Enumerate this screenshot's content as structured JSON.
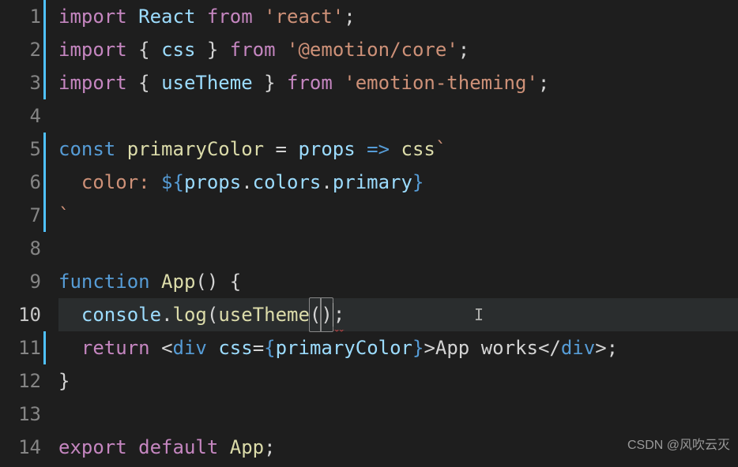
{
  "editor": {
    "activeLine": 10,
    "modifiedLines": [
      1,
      2,
      3,
      5,
      6,
      7,
      11
    ],
    "lines": [
      {
        "num": 1,
        "tokens": [
          {
            "cls": "tk-keyword",
            "t": "import"
          },
          {
            "cls": "tk-text",
            "t": " "
          },
          {
            "cls": "tk-var",
            "t": "React"
          },
          {
            "cls": "tk-text",
            "t": " "
          },
          {
            "cls": "tk-keyword",
            "t": "from"
          },
          {
            "cls": "tk-text",
            "t": " "
          },
          {
            "cls": "tk-string",
            "t": "'react'"
          },
          {
            "cls": "tk-punct",
            "t": ";"
          }
        ]
      },
      {
        "num": 2,
        "tokens": [
          {
            "cls": "tk-keyword",
            "t": "import"
          },
          {
            "cls": "tk-text",
            "t": " "
          },
          {
            "cls": "tk-brace",
            "t": "{ "
          },
          {
            "cls": "tk-var",
            "t": "css"
          },
          {
            "cls": "tk-brace",
            "t": " }"
          },
          {
            "cls": "tk-text",
            "t": " "
          },
          {
            "cls": "tk-keyword",
            "t": "from"
          },
          {
            "cls": "tk-text",
            "t": " "
          },
          {
            "cls": "tk-string",
            "t": "'@emotion/core'"
          },
          {
            "cls": "tk-punct",
            "t": ";"
          }
        ]
      },
      {
        "num": 3,
        "tokens": [
          {
            "cls": "tk-keyword",
            "t": "import"
          },
          {
            "cls": "tk-text",
            "t": " "
          },
          {
            "cls": "tk-brace",
            "t": "{ "
          },
          {
            "cls": "tk-var",
            "t": "useTheme"
          },
          {
            "cls": "tk-brace",
            "t": " }"
          },
          {
            "cls": "tk-text",
            "t": " "
          },
          {
            "cls": "tk-keyword",
            "t": "from"
          },
          {
            "cls": "tk-text",
            "t": " "
          },
          {
            "cls": "tk-string",
            "t": "'emotion-theming'"
          },
          {
            "cls": "tk-punct",
            "t": ";"
          }
        ]
      },
      {
        "num": 4,
        "tokens": []
      },
      {
        "num": 5,
        "tokens": [
          {
            "cls": "tk-storage",
            "t": "const"
          },
          {
            "cls": "tk-text",
            "t": " "
          },
          {
            "cls": "tk-func",
            "t": "primaryColor"
          },
          {
            "cls": "tk-text",
            "t": " "
          },
          {
            "cls": "tk-punct",
            "t": "="
          },
          {
            "cls": "tk-text",
            "t": " "
          },
          {
            "cls": "tk-var",
            "t": "props"
          },
          {
            "cls": "tk-text",
            "t": " "
          },
          {
            "cls": "tk-storage",
            "t": "=>"
          },
          {
            "cls": "tk-text",
            "t": " "
          },
          {
            "cls": "tk-func",
            "t": "css"
          },
          {
            "cls": "tk-string",
            "t": "`"
          }
        ]
      },
      {
        "num": 6,
        "tokens": [
          {
            "cls": "tk-string",
            "t": "  color: "
          },
          {
            "cls": "tk-tmpl",
            "t": "${"
          },
          {
            "cls": "tk-var",
            "t": "props"
          },
          {
            "cls": "tk-punct",
            "t": "."
          },
          {
            "cls": "tk-var",
            "t": "colors"
          },
          {
            "cls": "tk-punct",
            "t": "."
          },
          {
            "cls": "tk-var",
            "t": "primary"
          },
          {
            "cls": "tk-tmpl",
            "t": "}"
          }
        ]
      },
      {
        "num": 7,
        "tokens": [
          {
            "cls": "tk-string",
            "t": "`"
          }
        ]
      },
      {
        "num": 8,
        "tokens": []
      },
      {
        "num": 9,
        "tokens": [
          {
            "cls": "tk-storage",
            "t": "function"
          },
          {
            "cls": "tk-text",
            "t": " "
          },
          {
            "cls": "tk-func",
            "t": "App"
          },
          {
            "cls": "tk-brace",
            "t": "()"
          },
          {
            "cls": "tk-text",
            "t": " "
          },
          {
            "cls": "tk-brace",
            "t": "{"
          }
        ]
      },
      {
        "num": 10,
        "tokens": [
          {
            "cls": "tk-text",
            "t": "  "
          },
          {
            "cls": "tk-var",
            "t": "console"
          },
          {
            "cls": "tk-punct",
            "t": "."
          },
          {
            "cls": "tk-func",
            "t": "log"
          },
          {
            "cls": "tk-brace",
            "t": "("
          },
          {
            "cls": "tk-func",
            "t": "useTheme"
          },
          {
            "cls": "tk-brace bracket-match",
            "t": "("
          },
          {
            "cls": "tk-brace bracket-match",
            "t": ")"
          },
          {
            "cls": "",
            "t": "",
            "cursor": true
          },
          {
            "cls": "tk-punct squiggle",
            "t": ";"
          }
        ]
      },
      {
        "num": 11,
        "tokens": [
          {
            "cls": "tk-text",
            "t": "  "
          },
          {
            "cls": "tk-keyword",
            "t": "return"
          },
          {
            "cls": "tk-text",
            "t": " "
          },
          {
            "cls": "tk-punct",
            "t": "<"
          },
          {
            "cls": "tk-tag",
            "t": "div"
          },
          {
            "cls": "tk-text",
            "t": " "
          },
          {
            "cls": "tk-attr",
            "t": "css"
          },
          {
            "cls": "tk-punct",
            "t": "="
          },
          {
            "cls": "tk-tmpl",
            "t": "{"
          },
          {
            "cls": "tk-var",
            "t": "primaryColor"
          },
          {
            "cls": "tk-tmpl",
            "t": "}"
          },
          {
            "cls": "tk-punct",
            "t": ">"
          },
          {
            "cls": "tk-text",
            "t": "App works"
          },
          {
            "cls": "tk-punct",
            "t": "</"
          },
          {
            "cls": "tk-tag",
            "t": "div"
          },
          {
            "cls": "tk-punct",
            "t": ">;"
          }
        ]
      },
      {
        "num": 12,
        "tokens": [
          {
            "cls": "tk-brace",
            "t": "}"
          }
        ]
      },
      {
        "num": 13,
        "tokens": []
      },
      {
        "num": 14,
        "tokens": [
          {
            "cls": "tk-keyword",
            "t": "export"
          },
          {
            "cls": "tk-text",
            "t": " "
          },
          {
            "cls": "tk-keyword",
            "t": "default"
          },
          {
            "cls": "tk-text",
            "t": " "
          },
          {
            "cls": "tk-func",
            "t": "App"
          },
          {
            "cls": "tk-punct",
            "t": ";"
          }
        ]
      }
    ]
  },
  "watermark": "CSDN @风吹云灭"
}
